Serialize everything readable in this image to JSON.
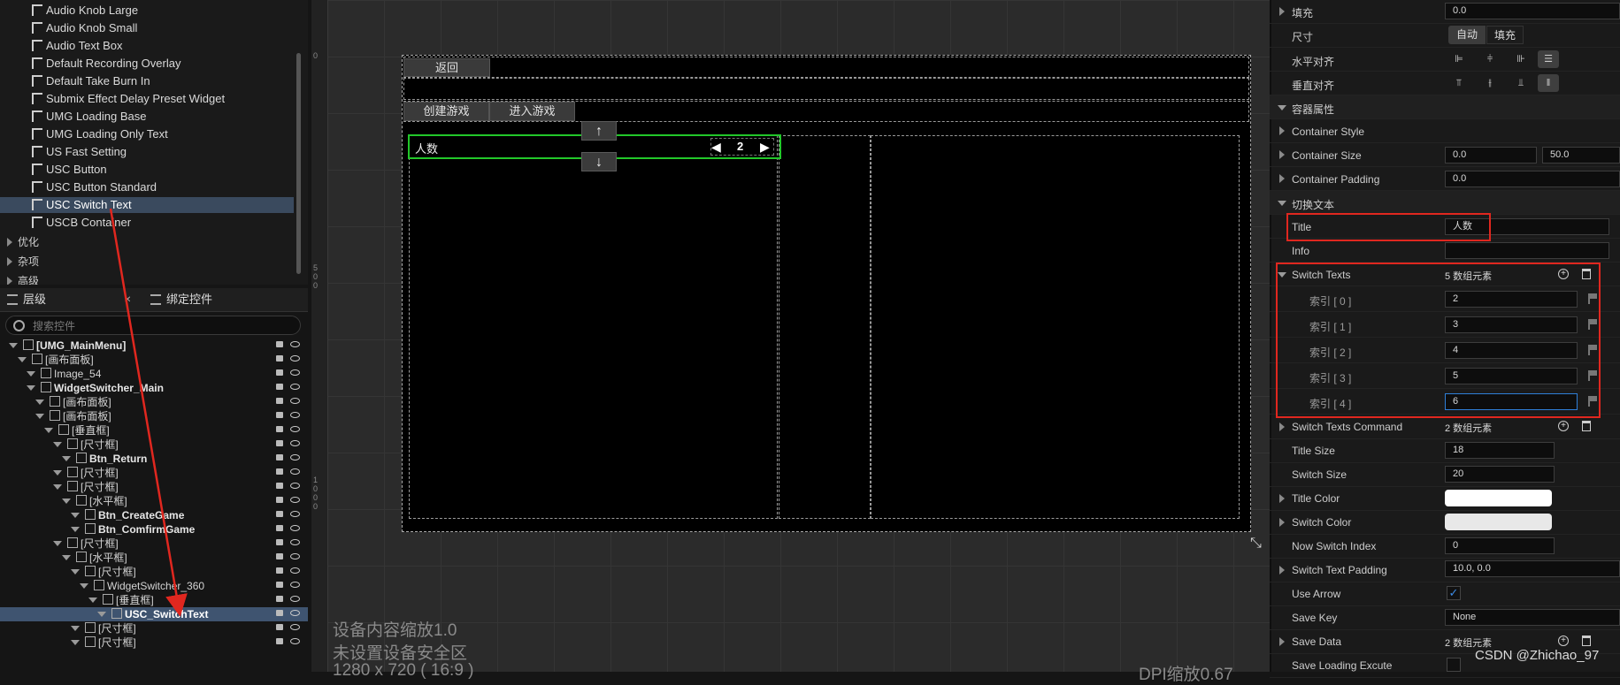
{
  "palette": {
    "items": [
      "Audio Knob Large",
      "Audio Knob Small",
      "Audio Text Box",
      "Default Recording Overlay",
      "Default Take Burn In",
      "Submix Effect Delay Preset Widget",
      "UMG Loading Base",
      "UMG Loading Only Text",
      "US Fast Setting",
      "USC Button",
      "USC Button Standard",
      "USC Switch Text",
      "USCB Container"
    ],
    "categories": [
      "优化",
      "杂项",
      "高级"
    ]
  },
  "hierarchy": {
    "tab_layers": "层级",
    "tab_bindings": "绑定控件",
    "search_placeholder": "搜索控件",
    "tree": [
      {
        "label": "[UMG_MainMenu]",
        "indent": 0,
        "bold": true
      },
      {
        "label": "[画布面板]",
        "indent": 1
      },
      {
        "label": "Image_54",
        "indent": 2
      },
      {
        "label": "WidgetSwitcher_Main",
        "indent": 2,
        "bold": true
      },
      {
        "label": "[画布面板]",
        "indent": 3
      },
      {
        "label": "[画布面板]",
        "indent": 3
      },
      {
        "label": "[垂直框]",
        "indent": 4
      },
      {
        "label": "[尺寸框]",
        "indent": 5
      },
      {
        "label": "Btn_Return",
        "indent": 6,
        "bold": true
      },
      {
        "label": "[尺寸框]",
        "indent": 5
      },
      {
        "label": "[尺寸框]",
        "indent": 5
      },
      {
        "label": "[水平框]",
        "indent": 6
      },
      {
        "label": "Btn_CreateGame",
        "indent": 7,
        "bold": true
      },
      {
        "label": "Btn_ComfirmGame",
        "indent": 7,
        "bold": true
      },
      {
        "label": "[尺寸框]",
        "indent": 5
      },
      {
        "label": "[水平框]",
        "indent": 6
      },
      {
        "label": "[尺寸框]",
        "indent": 7
      },
      {
        "label": "WidgetSwitcher_360",
        "indent": 8
      },
      {
        "label": "[垂直框]",
        "indent": 9
      },
      {
        "label": "USC_SwitchText",
        "indent": 10,
        "selected": true
      },
      {
        "label": "[尺寸框]",
        "indent": 7
      },
      {
        "label": "[尺寸框]",
        "indent": 7
      }
    ]
  },
  "canvas": {
    "ruler_top": "0",
    "ruler_mid": "500",
    "ruler_low": "1000",
    "btn_return": "返回",
    "btn_create": "创建游戏",
    "btn_enter": "进入游戏",
    "switch_title": "人数",
    "switch_value": "2",
    "arrow_up": "↑",
    "arrow_down": "↓",
    "info_scale": "设备内容缩放1.0",
    "info_safe": "未设置设备安全区",
    "info_res": "1280 x 720 ( 16:9 )",
    "info_dpi": "DPI缩放0.67"
  },
  "details": {
    "rows": {
      "fill_label": "填充",
      "fill_value": "0.0",
      "size_label": "尺寸",
      "size_auto": "自动",
      "size_fill": "填充",
      "halign_label": "水平对齐",
      "valign_label": "垂直对齐",
      "container_cat": "容器属性",
      "container_style": "Container Style",
      "container_size": "Container Size",
      "container_size_x": "0.0",
      "container_size_y": "50.0",
      "container_padding": "Container Padding",
      "container_padding_value": "0.0",
      "switch_cat": "切换文本",
      "title_label": "Title",
      "title_value": "人数",
      "info_label": "Info",
      "info_value": "",
      "switch_texts": "Switch Texts",
      "switch_texts_count": "5 数组元素",
      "switch_texts_command": "Switch Texts Command",
      "switch_texts_command_count": "2 数组元素",
      "title_size": "Title Size",
      "title_size_value": "18",
      "switch_size": "Switch Size",
      "switch_size_value": "20",
      "title_color": "Title Color",
      "switch_color": "Switch Color",
      "now_switch_index": "Now Switch Index",
      "now_switch_index_value": "0",
      "switch_text_padding": "Switch Text Padding",
      "switch_text_padding_value": "10.0, 0.0",
      "use_arrow": "Use Arrow",
      "save_key": "Save Key",
      "save_key_value": "None",
      "save_data": "Save Data",
      "save_data_count": "2 数组元素",
      "save_loading": "Save Loading Excute"
    },
    "indices": [
      {
        "label": "索引 [ 0 ]",
        "value": "2"
      },
      {
        "label": "索引 [ 1 ]",
        "value": "3"
      },
      {
        "label": "索引 [ 2 ]",
        "value": "4"
      },
      {
        "label": "索引 [ 3 ]",
        "value": "5"
      },
      {
        "label": "索引 [ 4 ]",
        "value": "6"
      }
    ]
  },
  "colors": {
    "selection": "#3f5470",
    "accent_red": "#e0271f",
    "switch_green": "#22c72a"
  },
  "watermark": "CSDN @Zhichao_97"
}
